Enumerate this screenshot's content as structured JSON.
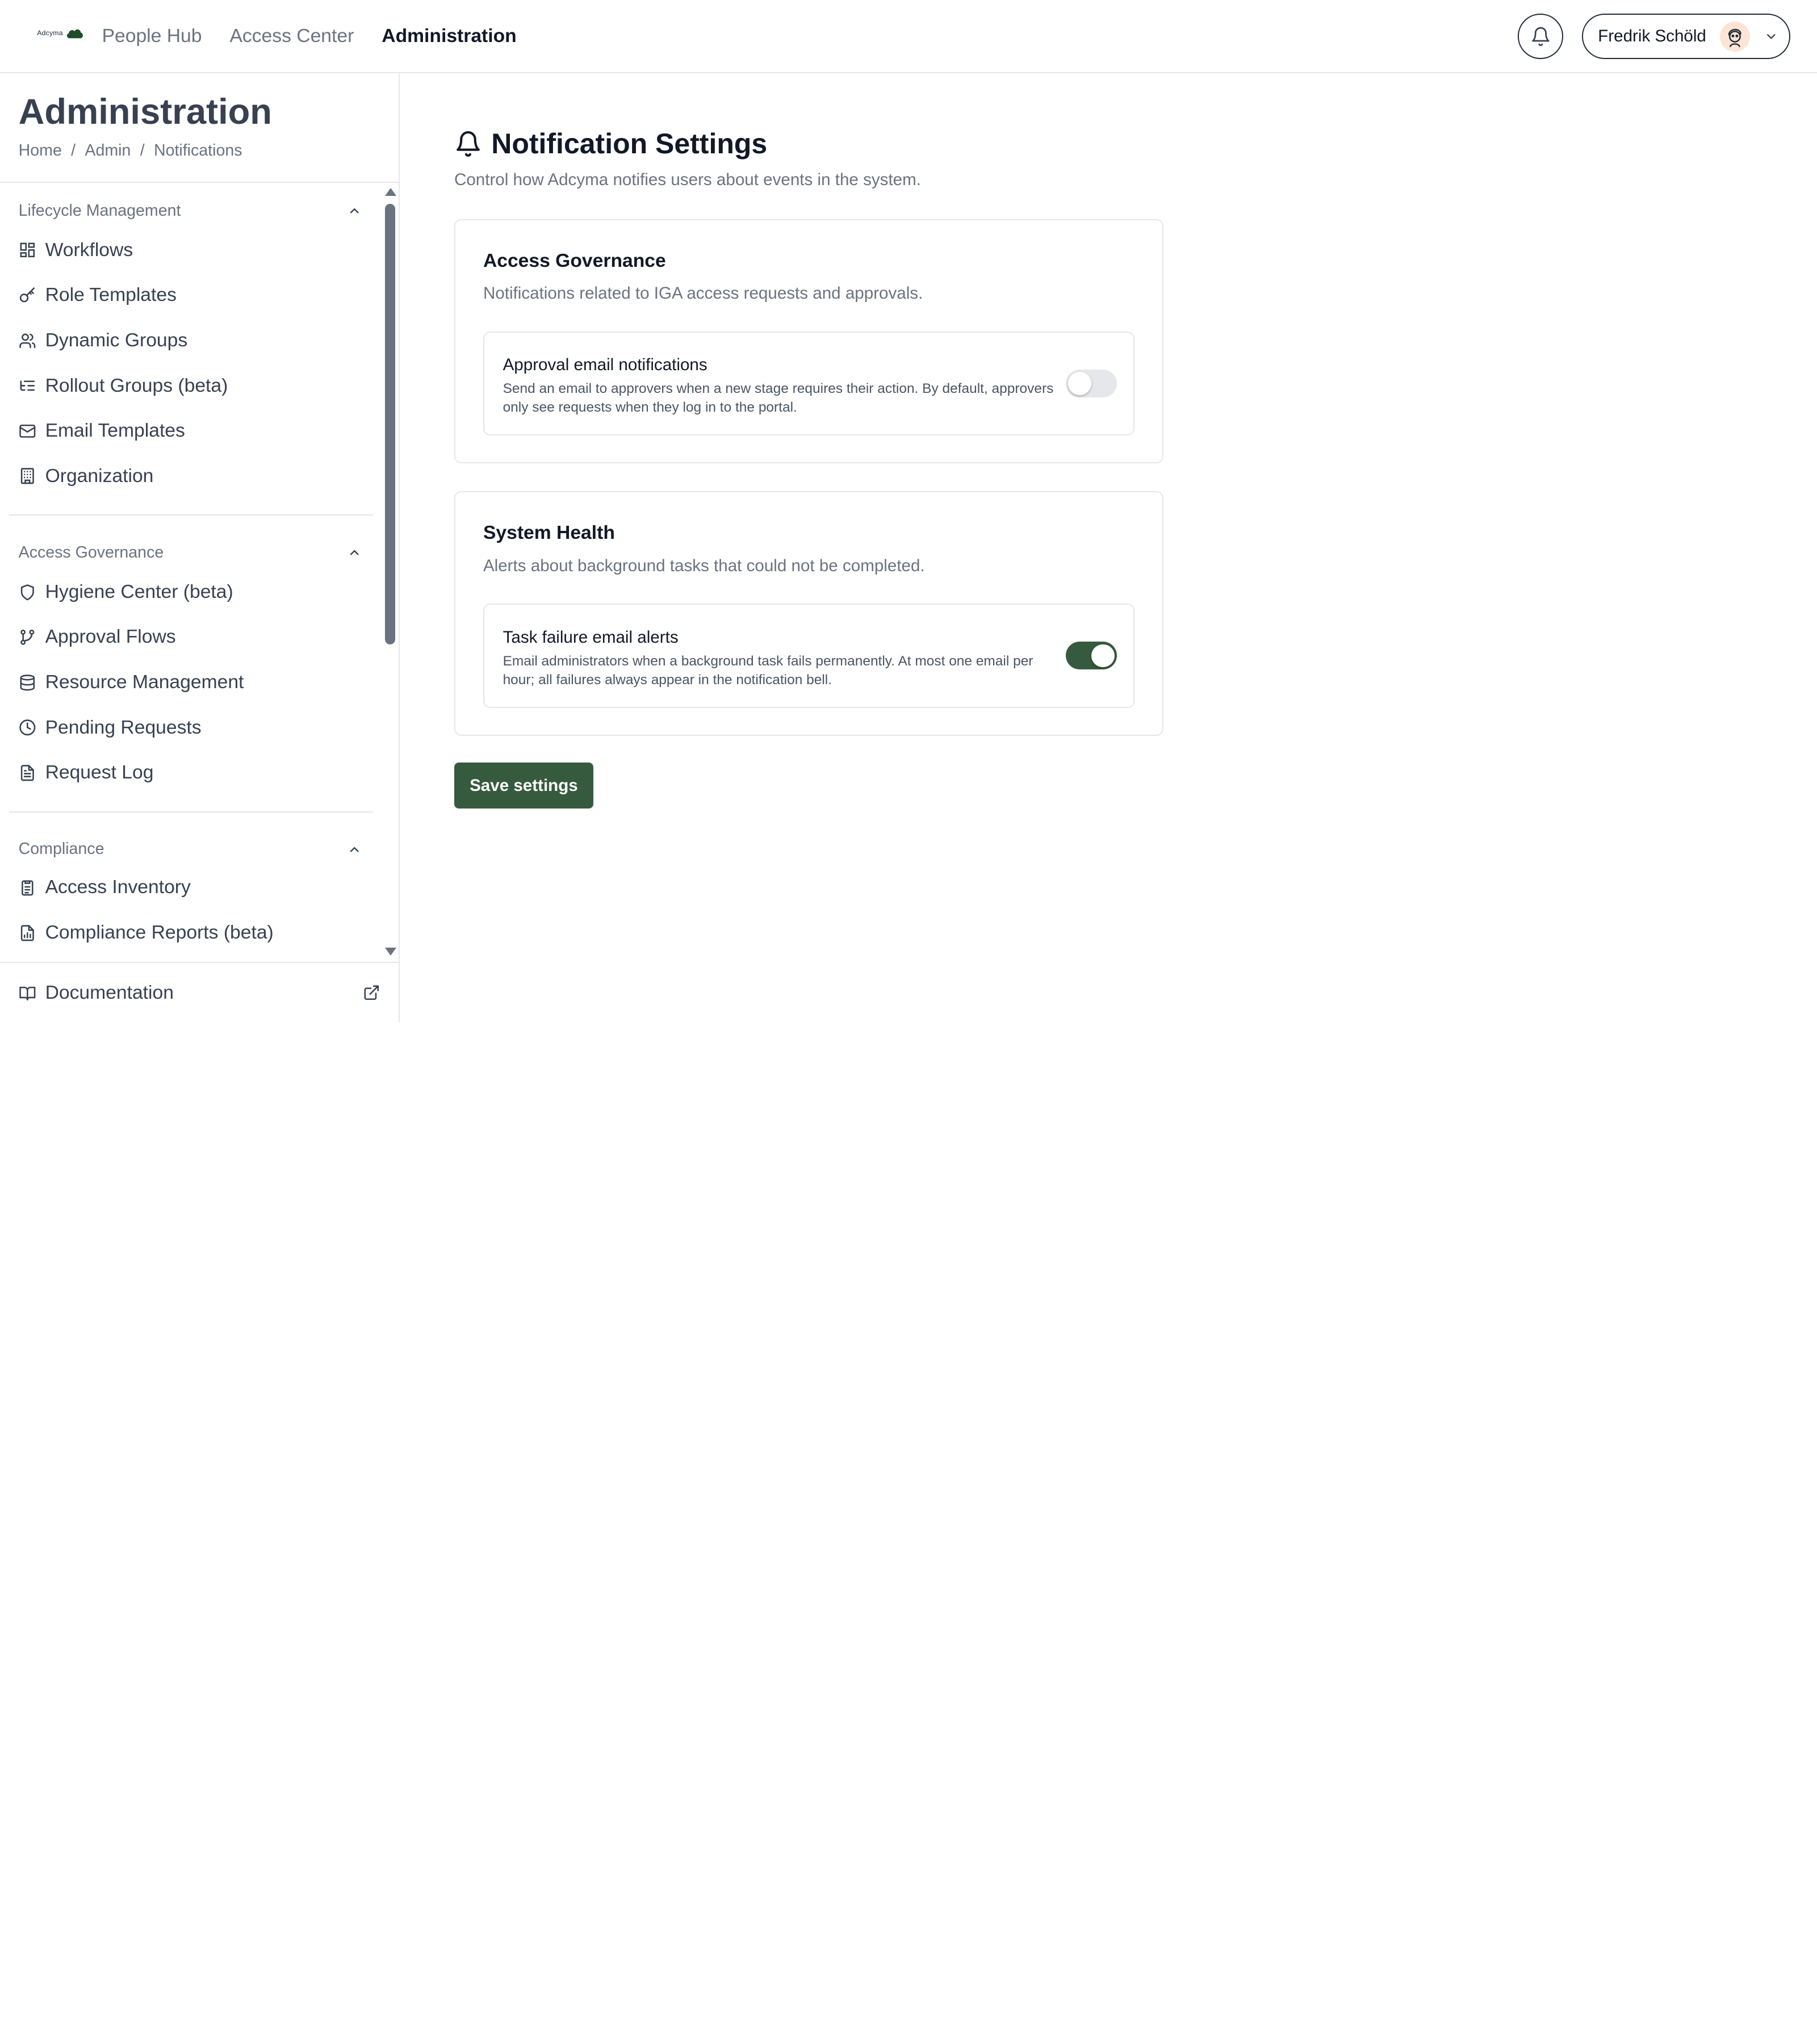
{
  "app": {
    "logo_text": "Adcyma",
    "top_nav": [
      {
        "label": "People Hub",
        "active": false
      },
      {
        "label": "Access Center",
        "active": false
      },
      {
        "label": "Administration",
        "active": true
      }
    ],
    "user_name": "Fredrik Schöld"
  },
  "sidebar": {
    "title": "Administration",
    "breadcrumb": [
      "Home",
      "Admin",
      "Notifications"
    ],
    "sections": [
      {
        "label": "Lifecycle Management",
        "items": [
          {
            "label": "Workflows",
            "icon": "grid-icon"
          },
          {
            "label": "Role Templates",
            "icon": "key-icon"
          },
          {
            "label": "Dynamic Groups",
            "icon": "users-icon"
          },
          {
            "label": "Rollout Groups (beta)",
            "icon": "list-tree-icon"
          },
          {
            "label": "Email Templates",
            "icon": "mail-icon"
          },
          {
            "label": "Organization",
            "icon": "building-icon"
          }
        ]
      },
      {
        "label": "Access Governance",
        "items": [
          {
            "label": "Hygiene Center (beta)",
            "icon": "shield-icon"
          },
          {
            "label": "Approval Flows",
            "icon": "git-branch-icon"
          },
          {
            "label": "Resource Management",
            "icon": "database-icon"
          },
          {
            "label": "Pending Requests",
            "icon": "clock-icon"
          },
          {
            "label": "Request Log",
            "icon": "file-text-icon"
          }
        ]
      },
      {
        "label": "Compliance",
        "items": [
          {
            "label": "Access Inventory",
            "icon": "clipboard-icon"
          },
          {
            "label": "Compliance Reports (beta)",
            "icon": "file-chart-icon"
          }
        ]
      }
    ],
    "footer_link": "Documentation"
  },
  "main": {
    "title": "Notification Settings",
    "subtitle": "Control how Adcyma notifies users about events in the system.",
    "cards": [
      {
        "title": "Access Governance",
        "description": "Notifications related to IGA access requests and approvals.",
        "setting": {
          "title": "Approval email notifications",
          "description": "Send an email to approvers when a new stage requires their action. By default, approvers only see requests when they log in to the portal.",
          "enabled": false
        }
      },
      {
        "title": "System Health",
        "description": "Alerts about background tasks that could not be completed.",
        "setting": {
          "title": "Task failure email alerts",
          "description": "Email administrators when a background task fails permanently. At most one email per hour; all failures always appear in the notification bell.",
          "enabled": true
        }
      }
    ],
    "save_label": "Save settings"
  },
  "colors": {
    "accent": "#365a3e",
    "border": "#e5e7eb",
    "muted_text": "#6b7280"
  }
}
